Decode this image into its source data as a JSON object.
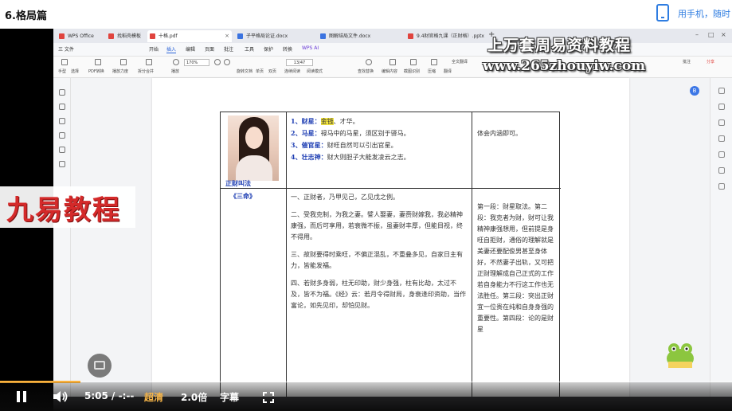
{
  "page": {
    "title": "6.格局篇",
    "phone_text": "用手机，随时"
  },
  "wps": {
    "tabs": [
      {
        "label": "WPS Office",
        "color": "#e0443e"
      },
      {
        "label": "找稻壳模板",
        "color": "#e0443e"
      },
      {
        "label": "十格.pdf",
        "color": "#e0443e"
      },
      {
        "label": "子平格局论证.docx",
        "color": "#3b73e0"
      },
      {
        "label": "图解结局文件.docx",
        "color": "#3b73e0"
      },
      {
        "label": "9.4财官格九课（正财格）.pptx",
        "color": "#e0443e"
      }
    ],
    "menus": [
      "三 文件",
      "开始",
      "插入",
      "编辑",
      "页面",
      "批注",
      "工具",
      "保护",
      "转换",
      "WPS AI"
    ],
    "active_menu": "开始",
    "zoom": "170%",
    "page_indicator": "13/47",
    "toolbar": [
      "手型",
      "选择",
      "PDF转换",
      "播放力度",
      "拆分合并",
      "播放",
      "旋转文档",
      "单页",
      "双页",
      "连续阅读",
      "阅读模式",
      "查找替换",
      "编辑内容",
      "截图识别",
      "压缩",
      "翻译",
      "全文翻译",
      "批注",
      "分享"
    ]
  },
  "watermark": {
    "title": "上万套周易资料教程",
    "url": "www.265zhouyiw.com"
  },
  "overlay": {
    "logo_text": "九易教程"
  },
  "document": {
    "photo_caption": "正财叫法",
    "sancming_label": "《三命》",
    "row1_items": [
      {
        "num": "1、",
        "key": "财星：",
        "hl": "金钱",
        "rest": "、才华。"
      },
      {
        "num": "2、",
        "key": "马星：",
        "hl": "",
        "rest": "禄马中的马星，须区别于驿马。"
      },
      {
        "num": "3、",
        "key": "催官星：",
        "hl": "",
        "rest": "财旺自然可以引出官星。"
      },
      {
        "num": "4、",
        "key": "壮志神：",
        "hl": "",
        "rest": "财大则胆子大能发凌云之志。"
      }
    ],
    "row1_right": "体会内涵即可。",
    "row2_mid": [
      "一、正财者，乃甲见己，乙见戊之例。",
      "二、受我克制，为我之妻。譬人娶妻，妻赍财嫁我，我必精神康强，而后可享用，若衰微不振，虽妻财丰厚，但能目视，终不得用。",
      "三、故财要得时乘旺，不偏正混乱，不重叠多见，自家日主有力，皆能发福。",
      "四、若财多身弱，柱无印助，财少身强，柱有比劫，太过不及，皆不为福。《经》云：若月令得财局，身衰逢印资助，当作富论，如先见印，却怕见财。"
    ],
    "row2_right": "第一段：财星取法。第二段：我克者为财，财可让我精神康强想用，但前提是身旺自拒财，通俗的理解就是美妻还要配俊男甚至身体好，不然妻子出轨，又可把正财理解成自己正式的工作若自身能力不行这工作也无法胜任。第三段：突出正财宜一位贵在纯和自身身强的重要性。第四段：论的是财星"
  },
  "player": {
    "time": "5:05 / -:--",
    "quality": "超清",
    "speed": "2.0倍",
    "subtitle": "字幕",
    "progress": 0.11
  }
}
